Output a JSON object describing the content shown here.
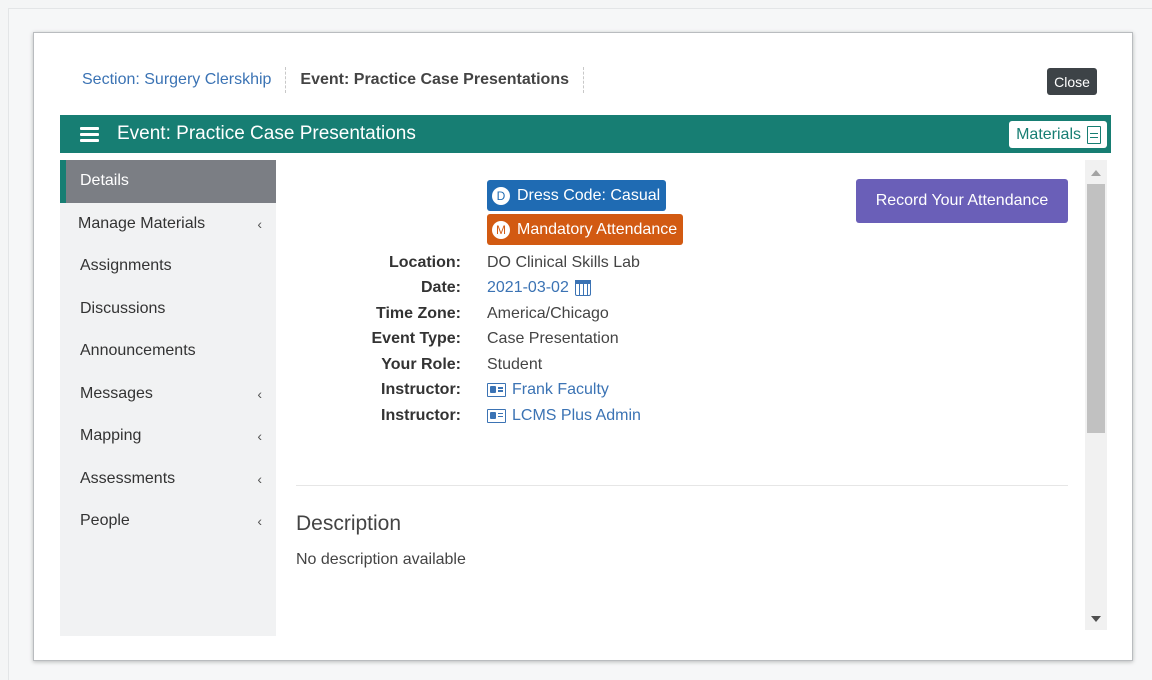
{
  "breadcrumb": {
    "section": "Section: Surgery Clerskhip",
    "event": "Event: Practice Case Presentations"
  },
  "close_label": "Close",
  "header": {
    "title": "Event: Practice Case Presentations",
    "materials_label": "Materials",
    "color": "#177e73"
  },
  "sidebar": {
    "items": [
      {
        "label": "Details",
        "active": true,
        "chevron": ""
      },
      {
        "label": "Manage Materials",
        "chevron": "‹"
      },
      {
        "label": "Assignments",
        "chevron": ""
      },
      {
        "label": "Discussions",
        "chevron": ""
      },
      {
        "label": "Announcements",
        "chevron": ""
      },
      {
        "label": "Messages",
        "chevron": "‹"
      },
      {
        "label": "Mapping",
        "chevron": "‹"
      },
      {
        "label": "Assessments",
        "chevron": "‹"
      },
      {
        "label": "People",
        "chevron": "‹"
      }
    ]
  },
  "badges": {
    "dress_code": {
      "letter": "D",
      "label": "Dress Code: Casual",
      "color": "#1f6bb3"
    },
    "mandatory": {
      "letter": "M",
      "label": "Mandatory Attendance",
      "color": "#d25a12"
    }
  },
  "record_attendance_label": "Record Your Attendance",
  "details": [
    {
      "label": "Location:",
      "value": "DO Clinical Skills Lab"
    },
    {
      "label": "Date:",
      "value": "2021-03-02"
    },
    {
      "label": "Time Zone:",
      "value": "America/Chicago"
    },
    {
      "label": "Event Type:",
      "value": "Case Presentation"
    },
    {
      "label": "Your Role:",
      "value": "Student"
    },
    {
      "label": "Instructor:",
      "value": "Frank Faculty"
    },
    {
      "label": "Instructor:",
      "value": "LCMS Plus Admin"
    }
  ],
  "description": {
    "title": "Description",
    "body": "No description available"
  },
  "icons": {
    "menu": "hamburger-icon",
    "materials": "document-icon",
    "date": "calendar-icon",
    "instructor": "contact-card-icon",
    "submenu": "chevron-left-icon"
  }
}
